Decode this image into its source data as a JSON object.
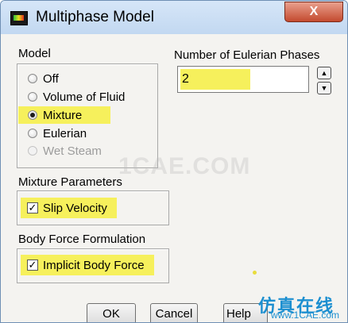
{
  "window": {
    "title": "Multiphase Model",
    "close_label": "X"
  },
  "model_group": {
    "label": "Model",
    "options": [
      {
        "label": "Off",
        "checked": false,
        "disabled": false
      },
      {
        "label": "Volume of Fluid",
        "checked": false,
        "disabled": false
      },
      {
        "label": "Mixture",
        "checked": true,
        "disabled": false
      },
      {
        "label": "Eulerian",
        "checked": false,
        "disabled": false
      },
      {
        "label": "Wet Steam",
        "checked": false,
        "disabled": true
      }
    ]
  },
  "phases": {
    "label": "Number of Eulerian Phases",
    "value": "2"
  },
  "mixture_parameters": {
    "label": "Mixture Parameters",
    "slip_velocity": {
      "label": "Slip Velocity",
      "checked": true
    }
  },
  "body_force": {
    "label": "Body Force Formulation",
    "implicit_body_force": {
      "label": "Implicit Body Force",
      "checked": true
    }
  },
  "buttons": {
    "ok": "OK",
    "cancel": "Cancel",
    "help": "Help"
  },
  "watermark": "1CAE.COM",
  "brand": {
    "name": "仿真在线",
    "url": "www.1CAE.com"
  },
  "colors": {
    "highlight": "#f6f05c",
    "titlebar": "#c8dcf3",
    "close": "#c44a2f",
    "brand": "#1c8fd0"
  }
}
